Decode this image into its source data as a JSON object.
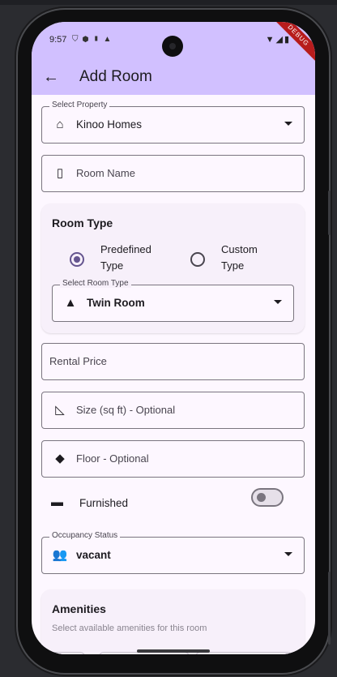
{
  "status_bar": {
    "time": "9:57",
    "left_icons": [
      "shield-icon",
      "privacy-icon",
      "sim-icon",
      "a-icon"
    ],
    "right_icons": [
      "wifi-icon",
      "signal-icon",
      "battery-icon"
    ],
    "debug_banner": "DEBUG"
  },
  "app_bar": {
    "title": "Add Room"
  },
  "property_field": {
    "label": "Select Property",
    "value": "Kinoo Homes",
    "icon": "home-icon"
  },
  "room_name_field": {
    "placeholder": "Room Name",
    "icon": "door-icon"
  },
  "room_type_card": {
    "title": "Room Type",
    "options": [
      {
        "label_line1": "Predefined",
        "label_line2": "Type",
        "selected": true
      },
      {
        "label_line1": "Custom",
        "label_line2": "Type",
        "selected": false
      }
    ],
    "select_label": "Select Room Type",
    "select_value": "Twin Room",
    "select_icon": "category-icon"
  },
  "rental_price_field": {
    "placeholder": "Rental Price"
  },
  "size_field": {
    "placeholder": "Size (sq ft) - Optional",
    "icon": "square-foot-icon"
  },
  "floor_field": {
    "placeholder": "Floor - Optional",
    "icon": "layers-icon"
  },
  "furnished_row": {
    "label": "Furnished",
    "icon": "chair-icon",
    "enabled": false
  },
  "occupancy_field": {
    "label": "Occupancy Status",
    "value": "vacant",
    "icon": "people-icon"
  },
  "amenities_card": {
    "title": "Amenities",
    "subtitle": "Select available amenities for this room"
  },
  "colors": {
    "app_bar": "#d1c0ff",
    "background": "#fdf7ff",
    "primary": "#65558f",
    "outline": "#7a757f"
  }
}
